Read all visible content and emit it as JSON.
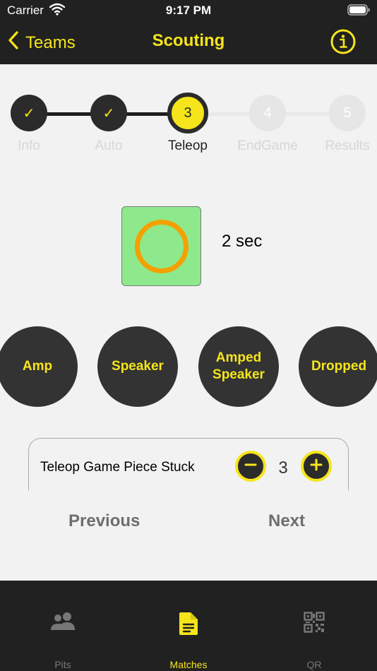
{
  "status_bar": {
    "carrier": "Carrier",
    "time": "9:17 PM"
  },
  "nav": {
    "back_label": "Teams",
    "title": "Scouting"
  },
  "stepper": {
    "steps": [
      {
        "label": "Info",
        "marker": "✓",
        "state": "done"
      },
      {
        "label": "Auto",
        "marker": "✓",
        "state": "done"
      },
      {
        "label": "Teleop",
        "marker": "3",
        "state": "current"
      },
      {
        "label": "EndGame",
        "marker": "4",
        "state": "todo"
      },
      {
        "label": "Results",
        "marker": "5",
        "state": "todo"
      }
    ]
  },
  "timer": {
    "text": "2 sec"
  },
  "scoring": {
    "amp": "Amp",
    "speaker": "Speaker",
    "amped_speaker_line1": "Amped",
    "amped_speaker_line2": "Speaker",
    "dropped": "Dropped"
  },
  "counter": {
    "label": "Teleop Game Piece Stuck",
    "value": "3"
  },
  "pager": {
    "previous": "Previous",
    "next": "Next"
  },
  "tabs": {
    "pits": "Pits",
    "matches": "Matches",
    "qr": "QR"
  },
  "colors": {
    "accent": "#f6e51b",
    "dark": "#212121",
    "timer_fill": "#8ee98c",
    "timer_ring": "#f5a000"
  }
}
